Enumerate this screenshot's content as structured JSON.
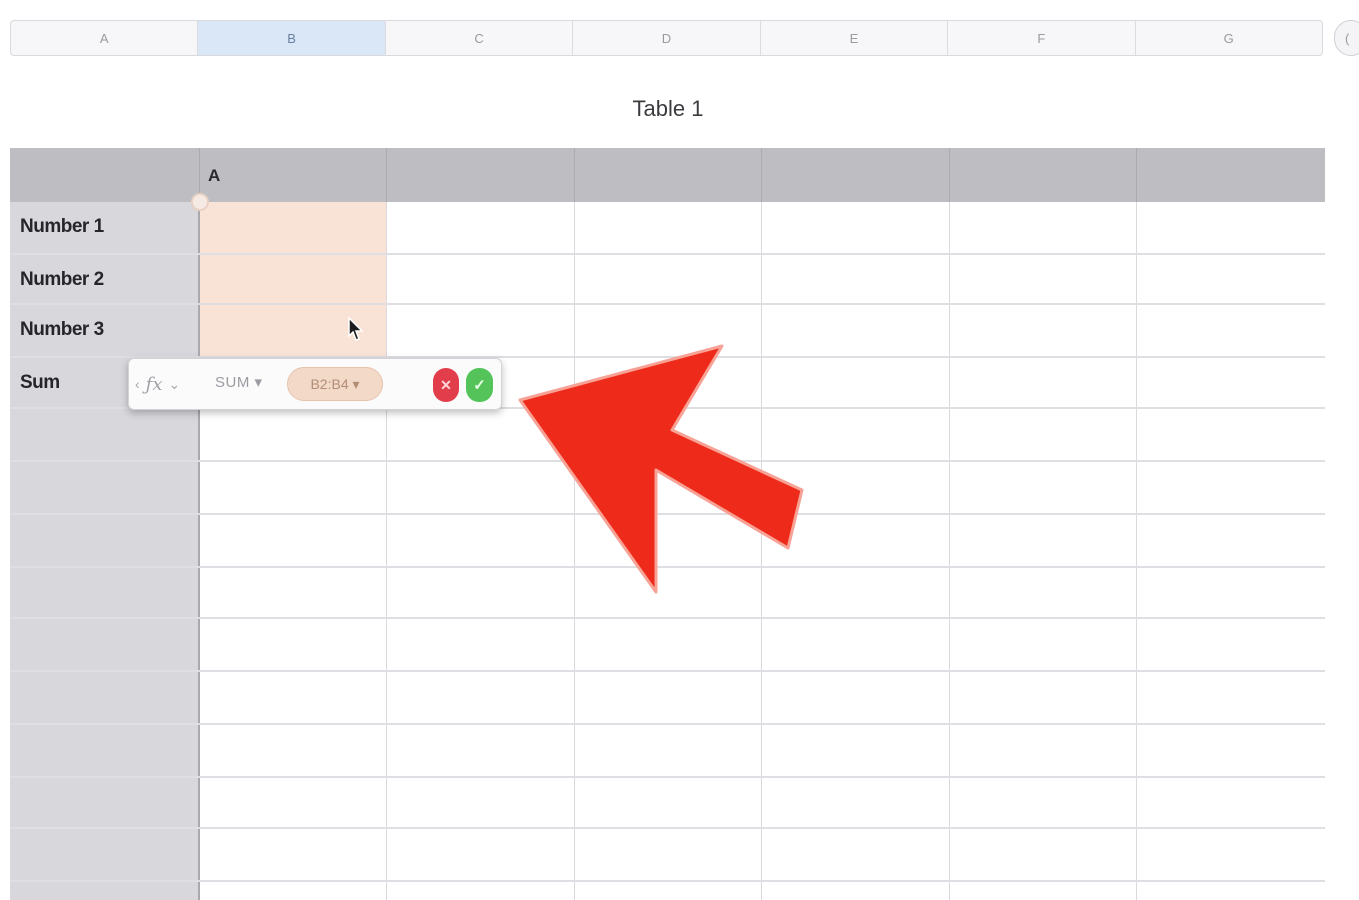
{
  "column_bar": {
    "letters": [
      "A",
      "B",
      "C",
      "D",
      "E",
      "F",
      "G"
    ],
    "selected_index": 1,
    "handle_glyph": "("
  },
  "table": {
    "title": "Table 1",
    "header_label": "A",
    "row_labels": [
      "Number 1",
      "Number 2",
      "Number 3",
      "Sum"
    ]
  },
  "formula_editor": {
    "function_name": "SUM",
    "range_token": "B2:B4",
    "cancel_glyph": "✕",
    "confirm_glyph": "✓"
  },
  "annotation": {
    "arrow_color": "#ee2a1a",
    "arrow_outline": "#f7a295"
  },
  "colors": {
    "selection_fill": "#f9e2d6",
    "header_fill": "#bdbdc2",
    "cancel": "#e23d4b",
    "confirm": "#54c35a"
  }
}
